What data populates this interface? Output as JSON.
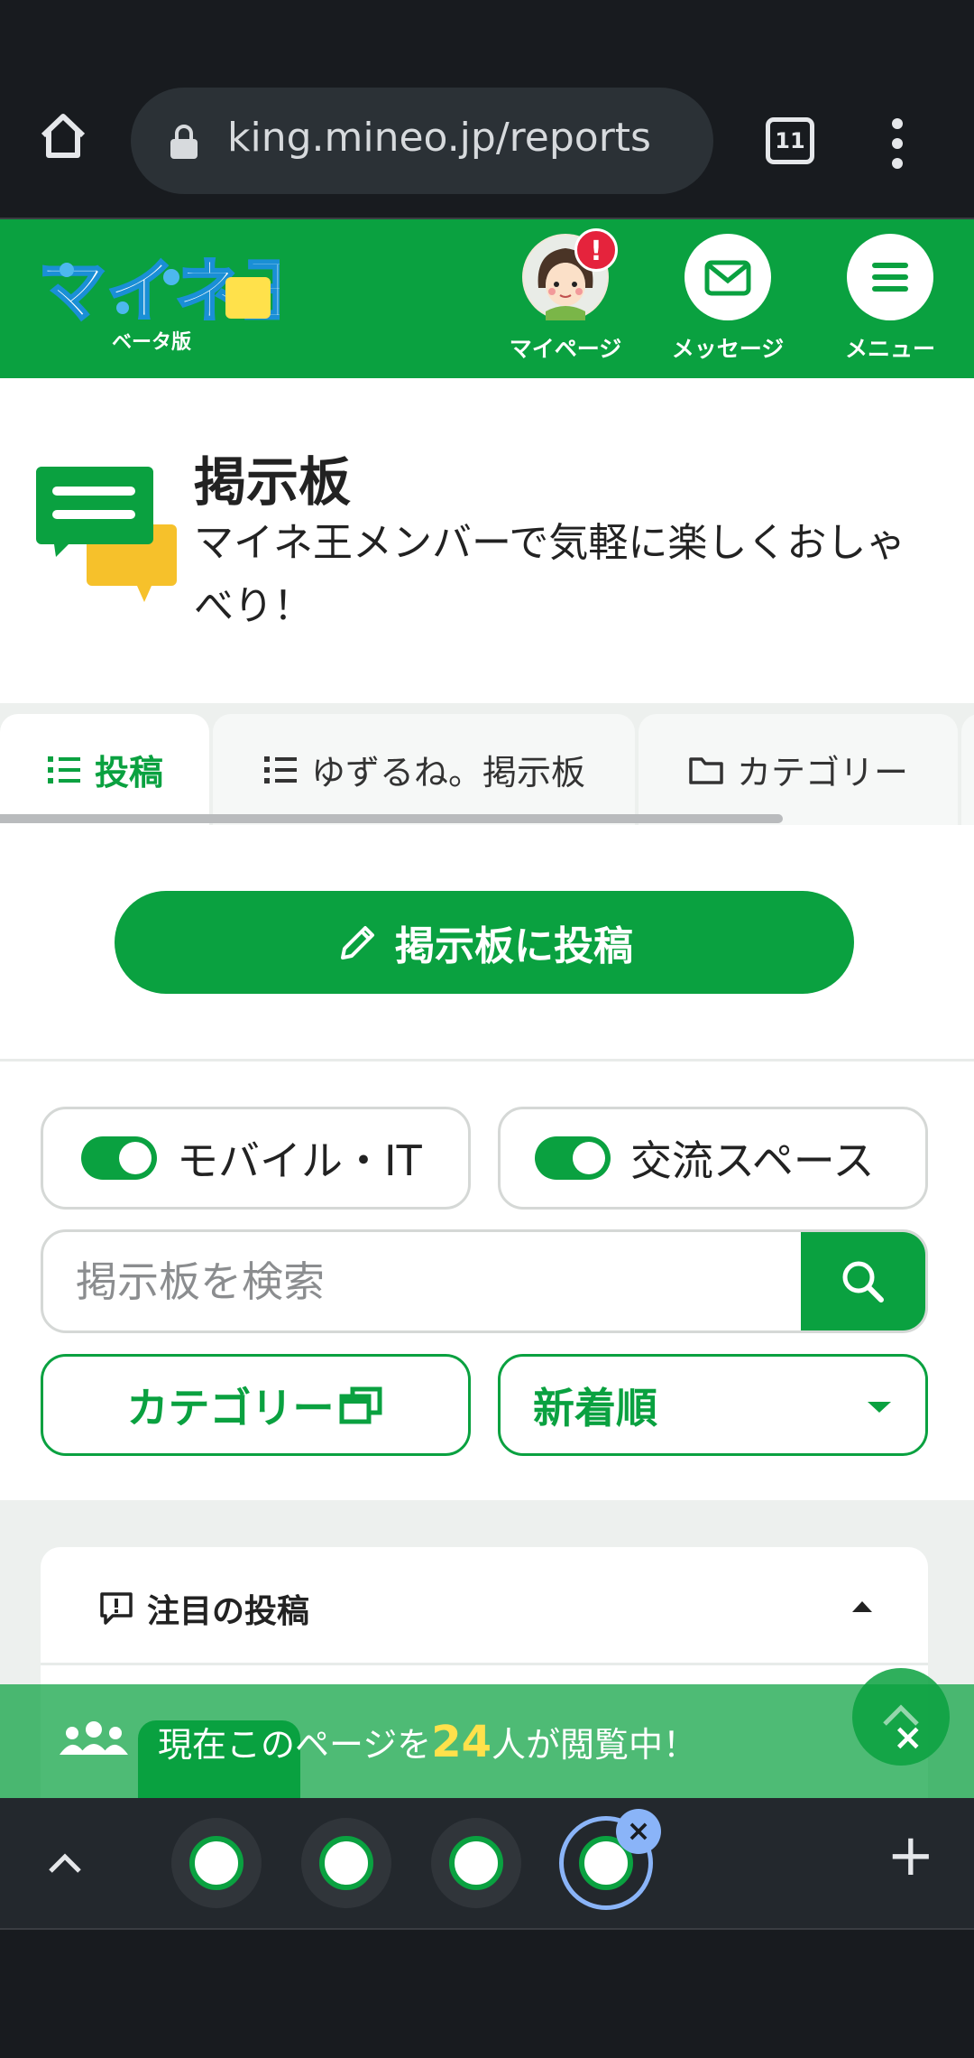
{
  "browser": {
    "url": "king.mineo.jp/reports",
    "tab_count": "11"
  },
  "header": {
    "logo_text": "マイネ王",
    "logo_sub": "ベータ版",
    "mypage_label": "マイページ",
    "mypage_badge": "!",
    "message_label": "メッセージ",
    "menu_label": "メニュー",
    "brand_color": "#0aa140"
  },
  "page": {
    "title": "掲示板",
    "subtitle": "マイネ王メンバーで気軽に楽しくおしゃべり！"
  },
  "tabs": [
    {
      "label": "投稿",
      "icon": "list-icon",
      "active": true
    },
    {
      "label": "ゆずるね。掲示板",
      "icon": "list-icon",
      "active": false
    },
    {
      "label": "カテゴリー",
      "icon": "folder-icon",
      "active": false
    }
  ],
  "post_button": {
    "label": "掲示板に投稿",
    "icon": "pencil-icon"
  },
  "filters": {
    "toggle_mobile": {
      "label": "モバイル・IT",
      "on": true
    },
    "toggle_social": {
      "label": "交流スペース",
      "on": true
    },
    "search_placeholder": "掲示板を検索",
    "category_button": "カテゴリー",
    "sort_select": "新着順"
  },
  "featured": {
    "heading": "注目の投稿"
  },
  "banner": {
    "prefix": "現在このページを",
    "count": "24",
    "suffix": "人が閲覧中！",
    "close": "×"
  },
  "tab_group": {
    "close": "×",
    "plus": "+"
  }
}
